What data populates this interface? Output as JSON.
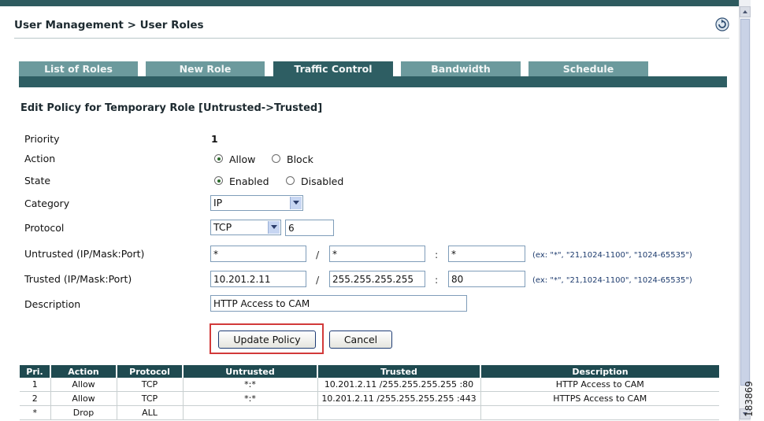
{
  "header": {
    "breadcrumb": "User Management > User Roles"
  },
  "tabs": [
    {
      "label": "List of Roles",
      "active": false
    },
    {
      "label": "New Role",
      "active": false
    },
    {
      "label": "Traffic Control",
      "active": true
    },
    {
      "label": "Bandwidth",
      "active": false
    },
    {
      "label": "Schedule",
      "active": false
    }
  ],
  "form": {
    "title": "Edit Policy for Temporary Role [Untrusted->Trusted]",
    "priority": {
      "label": "Priority",
      "value": "1"
    },
    "action": {
      "label": "Action",
      "options": [
        "Allow",
        "Block"
      ],
      "selected": "Allow"
    },
    "state": {
      "label": "State",
      "options": [
        "Enabled",
        "Disabled"
      ],
      "selected": "Enabled"
    },
    "category": {
      "label": "Category",
      "value": "IP"
    },
    "protocol": {
      "label": "Protocol",
      "value": "TCP",
      "number": "6"
    },
    "untrusted": {
      "label": "Untrusted (IP/Mask:Port)",
      "ip": "*",
      "mask": "*",
      "port": "*",
      "hint": "(ex: \"*\", \"21,1024-1100\", \"1024-65535\")"
    },
    "trusted": {
      "label": "Trusted (IP/Mask:Port)",
      "ip": "10.201.2.11",
      "mask": "255.255.255.255",
      "port": "80",
      "hint": "(ex: \"*\", \"21,1024-1100\", \"1024-65535\")"
    },
    "description": {
      "label": "Description",
      "value": "HTTP Access to CAM"
    },
    "separators": {
      "slash": "/",
      "colon": ":"
    },
    "buttons": {
      "update": "Update Policy",
      "cancel": "Cancel"
    }
  },
  "table": {
    "headers": [
      "Pri.",
      "Action",
      "Protocol",
      "Untrusted",
      "Trusted",
      "Description"
    ],
    "rows": [
      [
        "1",
        "Allow",
        "TCP",
        "*:*",
        "10.201.2.11 /255.255.255.255 :80",
        "HTTP Access to CAM"
      ],
      [
        "2",
        "Allow",
        "TCP",
        "*:*",
        "10.201.2.11 /255.255.255.255 :443",
        "HTTPS Access to CAM"
      ],
      [
        "*",
        "Drop",
        "ALL",
        "",
        "",
        ""
      ]
    ]
  },
  "figure_id": "183869",
  "colors": {
    "tab_active": "#2e5e63",
    "tab_inactive": "#6c9a9d",
    "highlight": "#d23a3a"
  }
}
